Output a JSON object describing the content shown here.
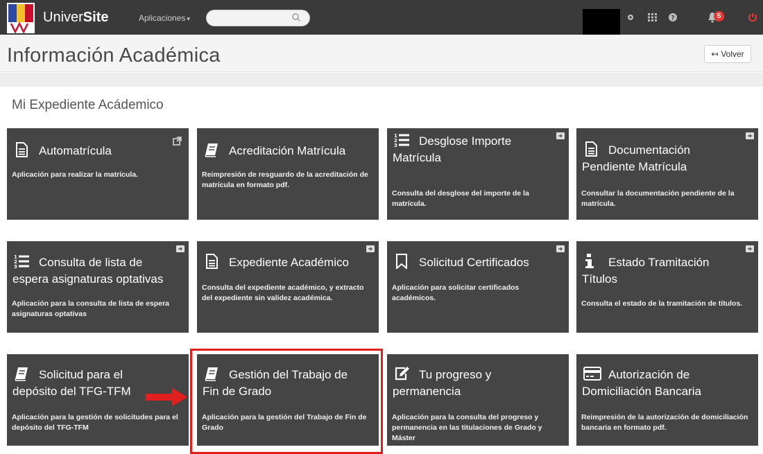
{
  "navbar": {
    "brand_prefix": "Univer",
    "brand_bold": "Site",
    "apps_label": "Aplicaciones",
    "search_placeholder": "",
    "notification_count": "5"
  },
  "header": {
    "title": "Información Académica",
    "back_label": "Volver"
  },
  "section": {
    "title": "Mi Expediente Acádemico"
  },
  "tiles": [
    {
      "title": "Automatrícula",
      "description": "Aplicación para realizar la matrícula.",
      "icon": "document-icon",
      "corner": "external-link-icon"
    },
    {
      "title": "Acreditación Matrícula",
      "description": "Reimpresión de resguardo de la acreditación de matrícula en formato pdf.",
      "icon": "book-icon",
      "corner": ""
    },
    {
      "title": "Desglose Importe Matrícula",
      "description": "Consulta del desglose del importe de la matrícula.",
      "icon": "numbered-list-icon",
      "corner": "sign-in-icon"
    },
    {
      "title": "Documentación Pendiente Matrícula",
      "description": "Consultar la documentación pendiente de la matrícula.",
      "icon": "document-icon",
      "corner": "sign-in-icon"
    },
    {
      "title": "Consulta de lista de espera asignaturas optativas",
      "description": "Aplicación para la consulta de lista de espera asignaturas optativas",
      "icon": "numbered-list-icon",
      "corner": "sign-in-icon"
    },
    {
      "title": "Expediente Académico",
      "description": "Consulta del expediente académico, y extracto del expediente sin validez académica.",
      "icon": "document-icon",
      "corner": "sign-in-icon"
    },
    {
      "title": "Solicitud Certificados",
      "description": "Aplicación para solicitar certificados académicos.",
      "icon": "bookmark-icon",
      "corner": "sign-in-icon"
    },
    {
      "title": "Estado Tramitación Títulos",
      "description": "Consulta el estado de la tramitación de títulos.",
      "icon": "info-icon",
      "corner": "sign-in-icon"
    },
    {
      "title": "Solicitud para el depósito del TFG-TFM",
      "description": "Aplicación para la gestión de solicitudes para el depósito del TFG-TFM",
      "icon": "book-icon",
      "corner": ""
    },
    {
      "title": "Gestión del Trabajo de Fin de Grado",
      "description": "Aplicación para la gestión del Trabajo de Fin de Grado",
      "icon": "book-icon",
      "corner": ""
    },
    {
      "title": "Tu progreso y permanencia",
      "description": "Aplicación para la consulta del progreso y permanencia en las titulaciones de Grado y Máster",
      "icon": "edit-icon",
      "corner": ""
    },
    {
      "title": "Autorización de Domiciliación Bancaria",
      "description": "Reimpresión de la autorización de domiciliación bancaria en formato pdf.",
      "icon": "credit-card-icon",
      "corner": ""
    }
  ],
  "colors": {
    "navbar": "#3a3a3a",
    "tile": "#454545",
    "highlight": "#e01f1f",
    "badge": "#e53935"
  }
}
